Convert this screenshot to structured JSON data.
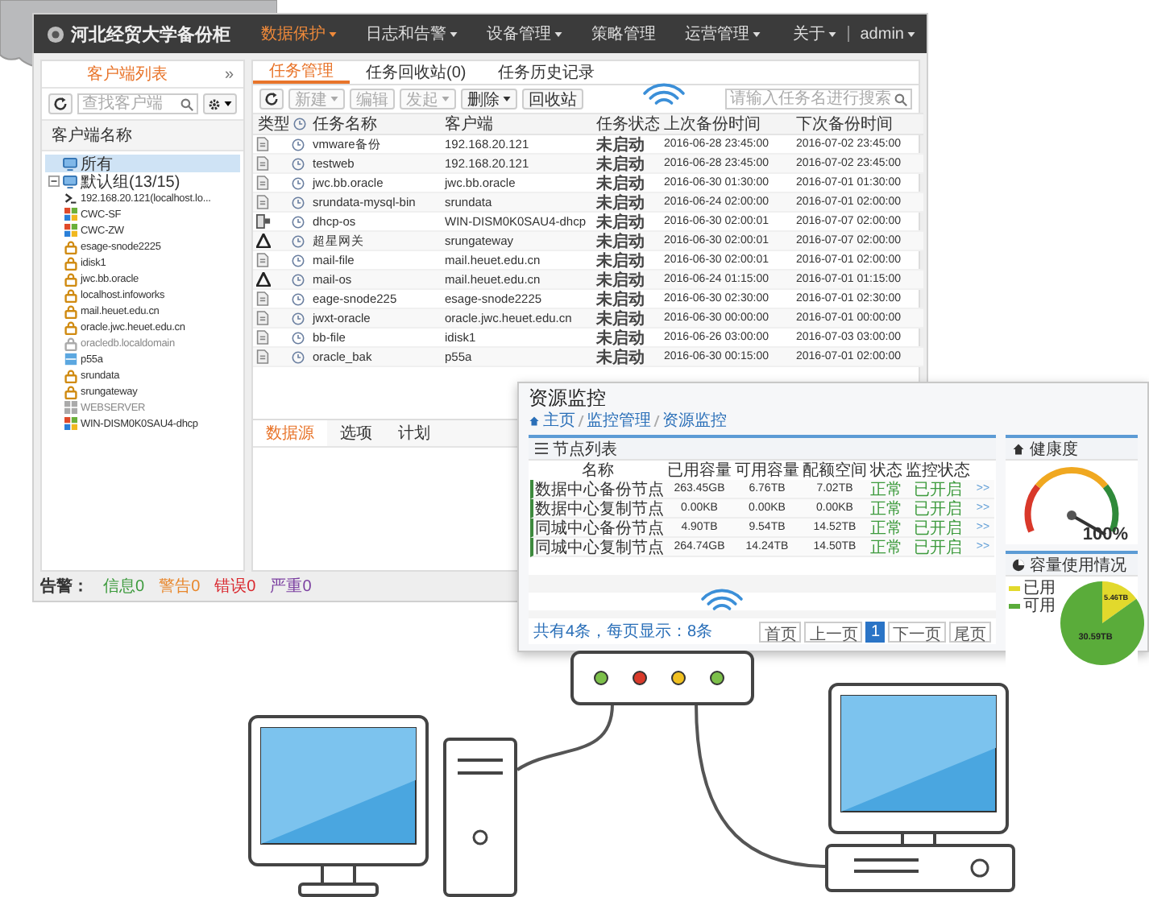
{
  "main_window": {
    "logo": "河北经贸大学备份柜",
    "nav": [
      {
        "label": "数据保护",
        "dropdown": true,
        "selected": true
      },
      {
        "label": "日志和告警",
        "dropdown": true,
        "selected": false
      },
      {
        "label": "设备管理",
        "dropdown": true,
        "selected": false
      },
      {
        "label": "策略管理",
        "dropdown": false,
        "selected": false
      },
      {
        "label": "运营管理",
        "dropdown": true,
        "selected": false
      }
    ],
    "user_menu": [
      {
        "label": "关于",
        "dropdown": true
      },
      {
        "label": "admin",
        "dropdown": true
      }
    ],
    "sidebar": {
      "tab": "客户端列表",
      "collapse": "»",
      "search_placeholder": "查找客户端",
      "column": "客户端名称",
      "tree": [
        {
          "label": "所有",
          "selected": true
        },
        {
          "label": "默认组(13/15)",
          "selected": false,
          "expanded": true,
          "children": [
            {
              "label": "192.168.20.121(localhost.lo...",
              "kind": "terminal",
              "online": true
            },
            {
              "label": "CWC-SF",
              "kind": "windows",
              "online": true
            },
            {
              "label": "CWC-ZW",
              "kind": "windows",
              "online": true
            },
            {
              "label": "esage-snode2225",
              "kind": "linux",
              "online": true
            },
            {
              "label": "idisk1",
              "kind": "linux",
              "online": true
            },
            {
              "label": "jwc.bb.oracle",
              "kind": "linux",
              "online": true
            },
            {
              "label": "localhost.infoworks",
              "kind": "linux",
              "online": true
            },
            {
              "label": "mail.heuet.edu.cn",
              "kind": "linux",
              "online": true
            },
            {
              "label": "oracle.jwc.heuet.edu.cn",
              "kind": "linux",
              "online": true
            },
            {
              "label": "oracledb.localdomain",
              "kind": "linux",
              "online": false
            },
            {
              "label": "p55a",
              "kind": "storage",
              "online": true
            },
            {
              "label": "srundata",
              "kind": "linux",
              "online": true
            },
            {
              "label": "srungateway",
              "kind": "linux",
              "online": true
            },
            {
              "label": "WEBSERVER",
              "kind": "windows",
              "online": false
            },
            {
              "label": "WIN-DISM0K0SAU4-dhcp",
              "kind": "windows",
              "online": true
            }
          ]
        }
      ]
    },
    "tabs": [
      {
        "label": "任务管理",
        "selected": true
      },
      {
        "label": "任务回收站(0)",
        "selected": false
      },
      {
        "label": "任务历史记录",
        "selected": false
      }
    ],
    "toolbar": [
      {
        "label": "新建",
        "dropdown": true,
        "disabled": true
      },
      {
        "label": "编辑",
        "dropdown": false,
        "disabled": true
      },
      {
        "label": "发起",
        "dropdown": true,
        "disabled": true
      },
      {
        "label": "删除",
        "dropdown": true,
        "disabled": false
      },
      {
        "label": "回收站",
        "dropdown": false,
        "disabled": false
      }
    ],
    "search_placeholder": "请输入任务名进行搜索",
    "table": {
      "columns": [
        {
          "kind": "text",
          "label": "类型"
        },
        {
          "kind": "clock"
        },
        {
          "kind": "text",
          "label": "任务名称"
        },
        {
          "kind": "text",
          "label": "客户端"
        },
        {
          "kind": "text",
          "label": "任务状态"
        },
        {
          "kind": "text",
          "label": "上次备份时间"
        },
        {
          "kind": "text",
          "label": "下次备份时间"
        }
      ],
      "rows": [
        {
          "kind": "file",
          "name": "vmware备份",
          "client": "192.168.20.121",
          "status": "未启动",
          "last": "2016-06-28 23:45:00",
          "next": "2016-07-02 23:45:00"
        },
        {
          "kind": "file",
          "name": "testweb",
          "client": "192.168.20.121",
          "status": "未启动",
          "last": "2016-06-28 23:45:00",
          "next": "2016-07-02 23:45:00"
        },
        {
          "kind": "file",
          "name": "jwc.bb.oracle",
          "client": "jwc.bb.oracle",
          "status": "未启动",
          "last": "2016-06-30 01:30:00",
          "next": "2016-07-01 01:30:00"
        },
        {
          "kind": "file",
          "name": "srundata-mysql-bin",
          "client": "srundata",
          "status": "未启动",
          "last": "2016-06-24 02:00:00",
          "next": "2016-07-01 02:00:00"
        },
        {
          "kind": "server",
          "name": "dhcp-os",
          "client": "WIN-DISM0K0SAU4-dhcp",
          "status": "未启动",
          "last": "2016-06-30 02:00:01",
          "next": "2016-07-07 02:00:00"
        },
        {
          "kind": "system",
          "name": "超星网关",
          "client": "srungateway",
          "status": "未启动",
          "last": "2016-06-30 02:00:01",
          "next": "2016-07-07 02:00:00"
        },
        {
          "kind": "file",
          "name": "mail-file",
          "client": "mail.heuet.edu.cn",
          "status": "未启动",
          "last": "2016-06-30 02:00:01",
          "next": "2016-07-01 02:00:00"
        },
        {
          "kind": "system",
          "name": "mail-os",
          "client": "mail.heuet.edu.cn",
          "status": "未启动",
          "last": "2016-06-24 01:15:00",
          "next": "2016-07-01 01:15:00"
        },
        {
          "kind": "file",
          "name": "eage-snode225",
          "client": "esage-snode2225",
          "status": "未启动",
          "last": "2016-06-30 02:30:00",
          "next": "2016-07-01 02:30:00"
        },
        {
          "kind": "file",
          "name": "jwxt-oracle",
          "client": "oracle.jwc.heuet.edu.cn",
          "status": "未启动",
          "last": "2016-06-30 00:00:00",
          "next": "2016-07-01 00:00:00"
        },
        {
          "kind": "file",
          "name": "bb-file",
          "client": "idisk1",
          "status": "未启动",
          "last": "2016-06-26 03:00:00",
          "next": "2016-07-03 03:00:00"
        },
        {
          "kind": "file",
          "name": "oracle_bak",
          "client": "p55a",
          "status": "未启动",
          "last": "2016-06-30 00:15:00",
          "next": "2016-07-01 02:00:00"
        }
      ]
    },
    "bottom_tabs": [
      {
        "label": "数据源",
        "selected": true
      },
      {
        "label": "选项",
        "selected": false
      },
      {
        "label": "计划",
        "selected": false
      }
    ],
    "status_bar": {
      "label": "告警：",
      "counts": [
        {
          "label": "信息0",
          "color": "#3c9a3c"
        },
        {
          "label": "警告0",
          "color": "#e8862a"
        },
        {
          "label": "错误0",
          "color": "#d9262c"
        },
        {
          "label": "严重0",
          "color": "#7b3fa0"
        }
      ]
    }
  },
  "monitor_window": {
    "title": "资源监控",
    "breadcrumb": [
      "主页",
      "监控管理",
      "资源监控"
    ],
    "node_panel": {
      "title": "节点列表",
      "columns": [
        "名称",
        "已用容量",
        "可用容量",
        "配额空间",
        "状态",
        "监控状态"
      ],
      "rows": [
        {
          "name": "数据中心备份节点",
          "used": "263.45GB",
          "free": "6.76TB",
          "quota": "7.02TB",
          "status": "正常",
          "monitor": "已开启",
          "more": ">>"
        },
        {
          "name": "数据中心复制节点",
          "used": "0.00KB",
          "free": "0.00KB",
          "quota": "0.00KB",
          "status": "正常",
          "monitor": "已开启",
          "more": ">>"
        },
        {
          "name": "同城中心备份节点",
          "used": "4.90TB",
          "free": "9.54TB",
          "quota": "14.52TB",
          "status": "正常",
          "monitor": "已开启",
          "more": ">>"
        },
        {
          "name": "同城中心复制节点",
          "used": "264.74GB",
          "free": "14.24TB",
          "quota": "14.50TB",
          "status": "正常",
          "monitor": "已开启",
          "more": ">>"
        }
      ],
      "footer": "共有4条，每页显示：8条",
      "pagination": [
        {
          "label": "首页",
          "selected": false
        },
        {
          "label": "上一页",
          "selected": false
        },
        {
          "label": "1",
          "selected": true
        },
        {
          "label": "下一页",
          "selected": false
        },
        {
          "label": "尾页",
          "selected": false
        }
      ]
    },
    "health_panel": {
      "title": "健康度",
      "reading": "100%"
    },
    "capacity_panel": {
      "title": "容量使用情况",
      "chart_data": {
        "type": "pie",
        "categories": [
          "已用",
          "可用"
        ],
        "values": [
          5.46,
          30.59
        ],
        "value_labels": [
          "5.46TB",
          "30.59TB"
        ]
      }
    }
  }
}
